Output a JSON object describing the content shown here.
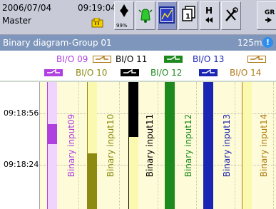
{
  "header": {
    "date": "2006/07/04",
    "time": "09:19:04",
    "user": "Master"
  },
  "toolbar": {
    "buttons": [
      {
        "name": "storage-button",
        "icon": "diamond-arrows-icon",
        "caption": "99%"
      },
      {
        "name": "alarm-button",
        "icon": "bell-icon"
      },
      {
        "name": "trend-view-button",
        "icon": "trend-chart-icon"
      },
      {
        "name": "display-switch-button",
        "icon": "pages-icon"
      },
      {
        "name": "history-button",
        "icon": "h-rewind-icon"
      },
      {
        "name": "settings-button",
        "icon": "tools-icon"
      },
      {
        "name": "group-next-button",
        "icon": "group-arrow-icon"
      }
    ]
  },
  "title": {
    "text": "Binary diagram-Group 01",
    "rate": "125ms",
    "info": "!"
  },
  "legend": [
    {
      "label": "BI/O 09",
      "color": "#b040e0",
      "state": "off"
    },
    {
      "label": "BI/O 10",
      "color": "#8c8a10",
      "state": "on"
    },
    {
      "label": "BI/O 11",
      "color": "#000000",
      "state": "off"
    },
    {
      "label": "BI/O 12",
      "color": "#1e8a1e",
      "state": "on"
    },
    {
      "label": "BI/O 13",
      "color": "#1b25b4",
      "state": "off"
    },
    {
      "label": "BI/O 14",
      "color": "#b07a18",
      "state": "on"
    }
  ],
  "time_labels": [
    "09:18:56",
    "09:18:24"
  ],
  "channels": [
    {
      "label": "Binary input09",
      "color": "#b040e0",
      "pale": "#f0d4ff",
      "segments": [
        [
          0,
          0.0,
          0.33
        ],
        [
          1,
          0.33,
          0.49
        ],
        [
          0,
          0.49,
          1.0
        ]
      ]
    },
    {
      "label": "Binary input10",
      "color": "#8c8a10",
      "pale": "#fbf8b0",
      "segments": [
        [
          0,
          0.0,
          0.56
        ],
        [
          1,
          0.56,
          1.0
        ]
      ]
    },
    {
      "label": "Binary input11",
      "color": "#000000",
      "pale": "#fbf8b0",
      "segments": [
        [
          1,
          0.0,
          0.43
        ],
        [
          0,
          0.43,
          1.0
        ]
      ]
    },
    {
      "label": "Binary input12",
      "color": "#1e8a1e",
      "pale": "#fbf8b0",
      "segments": [
        [
          1,
          0.0,
          1.0
        ]
      ]
    },
    {
      "label": "Binary input13",
      "color": "#1b25b4",
      "pale": "#fbf8b0",
      "segments": [
        [
          1,
          0.0,
          1.0
        ]
      ]
    },
    {
      "label": "Binary input14",
      "color": "#b07a18",
      "pale": "#fbf8b0",
      "segments": [
        [
          0,
          0.0,
          1.0
        ]
      ]
    }
  ]
}
